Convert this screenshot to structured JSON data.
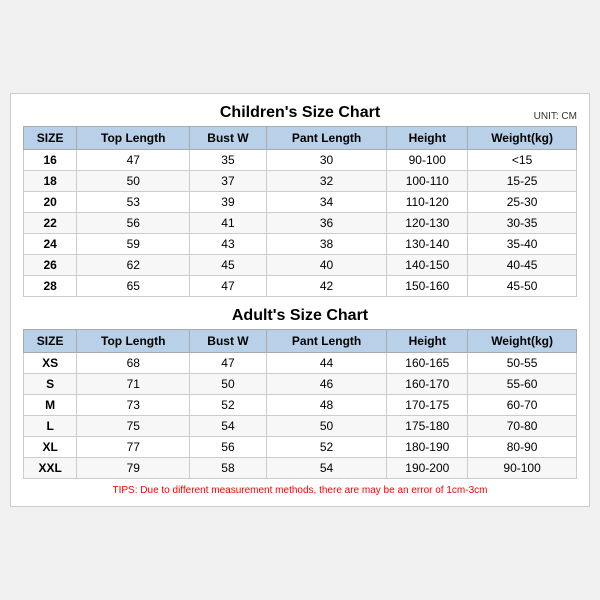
{
  "children_chart": {
    "title": "Children's Size Chart",
    "unit": "UNIT: CM",
    "headers": [
      "SIZE",
      "Top Length",
      "Bust W",
      "Pant Length",
      "Height",
      "Weight(kg)"
    ],
    "rows": [
      [
        "16",
        "47",
        "35",
        "30",
        "90-100",
        "<15"
      ],
      [
        "18",
        "50",
        "37",
        "32",
        "100-110",
        "15-25"
      ],
      [
        "20",
        "53",
        "39",
        "34",
        "110-120",
        "25-30"
      ],
      [
        "22",
        "56",
        "41",
        "36",
        "120-130",
        "30-35"
      ],
      [
        "24",
        "59",
        "43",
        "38",
        "130-140",
        "35-40"
      ],
      [
        "26",
        "62",
        "45",
        "40",
        "140-150",
        "40-45"
      ],
      [
        "28",
        "65",
        "47",
        "42",
        "150-160",
        "45-50"
      ]
    ]
  },
  "adults_chart": {
    "title": "Adult's Size Chart",
    "headers": [
      "SIZE",
      "Top Length",
      "Bust W",
      "Pant Length",
      "Height",
      "Weight(kg)"
    ],
    "rows": [
      [
        "XS",
        "68",
        "47",
        "44",
        "160-165",
        "50-55"
      ],
      [
        "S",
        "71",
        "50",
        "46",
        "160-170",
        "55-60"
      ],
      [
        "M",
        "73",
        "52",
        "48",
        "170-175",
        "60-70"
      ],
      [
        "L",
        "75",
        "54",
        "50",
        "175-180",
        "70-80"
      ],
      [
        "XL",
        "77",
        "56",
        "52",
        "180-190",
        "80-90"
      ],
      [
        "XXL",
        "79",
        "58",
        "54",
        "190-200",
        "90-100"
      ]
    ]
  },
  "tips": "TIPS: Due to different measurement methods, there are may be an error of 1cm-3cm"
}
